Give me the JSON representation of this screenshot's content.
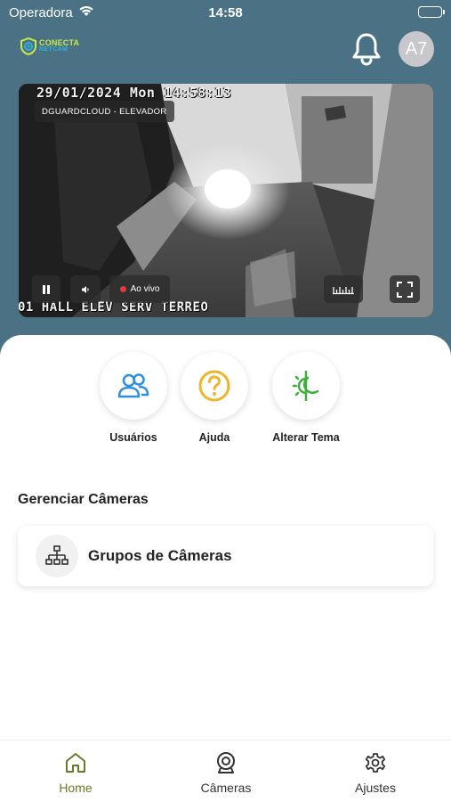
{
  "status_bar": {
    "carrier": "Operadora",
    "time": "14:58"
  },
  "header": {
    "logo_line1": "CONECTA",
    "logo_line2": "NETCAM",
    "notification_icon": "bell-icon",
    "avatar_initials": "A7"
  },
  "camera": {
    "timestamp": "29/01/2024 Mon 14:58:13",
    "name": "DGUARDCLOUD - ELEVADOR",
    "caption": "01 HALL ELEV SERV TERREO",
    "live_label": "Ao vivo",
    "controls": [
      "pause-icon",
      "volume-icon",
      "timeline-icon",
      "fullscreen-icon"
    ]
  },
  "quick_actions": [
    {
      "label": "Usuários",
      "icon": "users-icon",
      "color": "#2f8fe0"
    },
    {
      "label": "Ajuda",
      "icon": "help-icon",
      "color": "#f0b429"
    },
    {
      "label": "Alterar Tema",
      "icon": "theme-icon",
      "color": "#3fae3a"
    }
  ],
  "manage_cameras": {
    "title": "Gerenciar Câmeras",
    "items": [
      {
        "label": "Grupos de Câmeras",
        "icon": "sitemap-icon"
      }
    ]
  },
  "tab_bar": {
    "tabs": [
      {
        "label": "Home",
        "icon": "home-icon",
        "active": true
      },
      {
        "label": "Câmeras",
        "icon": "webcam-icon",
        "active": false
      },
      {
        "label": "Ajustes",
        "icon": "gear-icon",
        "active": false
      }
    ],
    "active_color": "#6a7a2a"
  },
  "colors": {
    "background": "#4a7284",
    "accent": "#6a7a2a",
    "live": "#e53935"
  }
}
